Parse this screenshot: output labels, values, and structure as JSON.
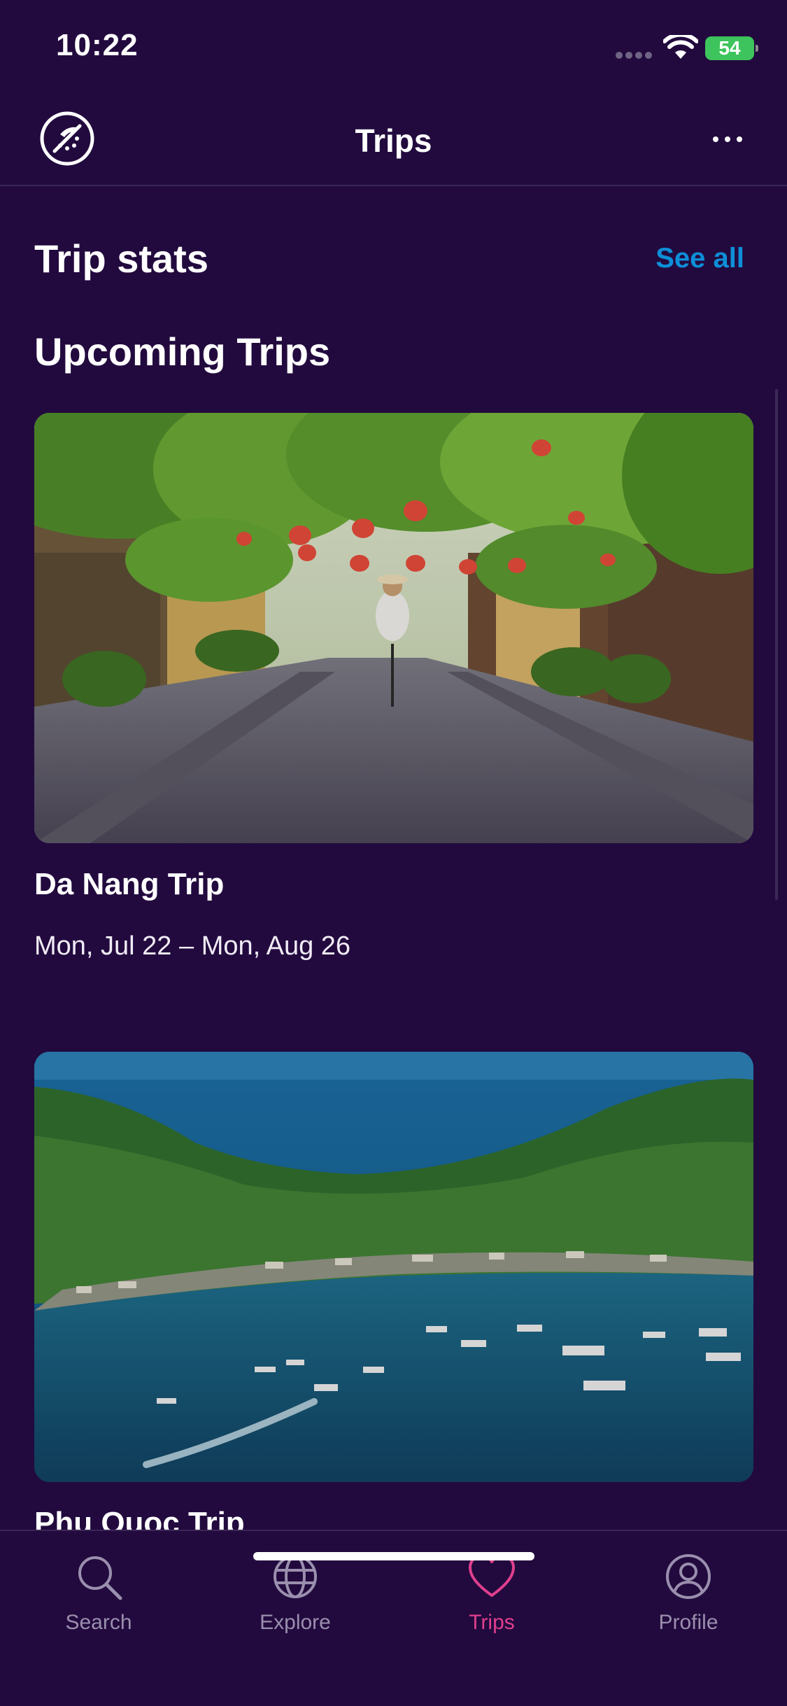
{
  "status_bar": {
    "time": "10:22",
    "battery": "54"
  },
  "nav": {
    "title": "Trips",
    "logo_icon": "no-flights-compass-icon",
    "more_icon": "more-dots-icon"
  },
  "trip_stats": {
    "title": "Trip stats",
    "see_all": "See all"
  },
  "upcoming": {
    "title": "Upcoming Trips",
    "trips": [
      {
        "name": "Da Nang Trip",
        "dates": "Mon, Jul 22 – Mon, Aug 26",
        "image": "lantern-street-photo"
      },
      {
        "name": "Phu Quoc Trip",
        "dates": "",
        "image": "bay-aerial-photo"
      }
    ]
  },
  "tabs": [
    {
      "label": "Search",
      "icon": "search-icon",
      "active": false
    },
    {
      "label": "Explore",
      "icon": "globe-icon",
      "active": false
    },
    {
      "label": "Trips",
      "icon": "heart-icon",
      "active": true
    },
    {
      "label": "Profile",
      "icon": "user-icon",
      "active": false
    }
  ],
  "colors": {
    "background": "#220a3e",
    "accent_link": "#0e8fd8",
    "active_tab": "#e03f8d",
    "inactive_tab": "#9a8fae"
  }
}
